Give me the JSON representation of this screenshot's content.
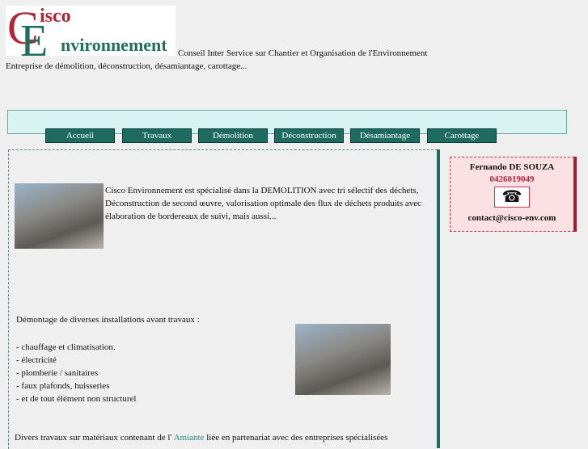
{
  "header": {
    "logo_text": "Cisco Environnement",
    "tagline": "Conseil Inter Service sur Chantier et Organisation de l'Environnement",
    "subtitle": "Entreprise de démolition, déconstruction, désamiantage, carottage..."
  },
  "nav": [
    "Accueil",
    "Travaux",
    "Démolition",
    "Déconstruction",
    "Désamiantage",
    "Carottage"
  ],
  "intro": "Cisco Environnement est spécialisé dans la DEMOLITION avec tri sélectif des déchets, Déconstruction de second œuvre, valorisation optimale des flux de déchets produits avec élaboration de bordereaux de suivi, mais aussi...",
  "demontage": {
    "title": "Démontage de diverses installations avant travaux :",
    "items": [
      "- chauffage et climatisation.",
      "- électricité",
      "- plomberie / sanitaires",
      "- faux plafonds, huisseries",
      "- et de tout élément non structurel"
    ]
  },
  "amiante": {
    "before": "Divers travaux sur matériaux contenant de l' ",
    "link": "Amiante",
    "after": " liée en partenariat avec des entreprises spécialisées"
  },
  "contact": {
    "name": "Fernando DE SOUZA",
    "phone": "0426019049",
    "email": "contact@cisco-env.com"
  }
}
